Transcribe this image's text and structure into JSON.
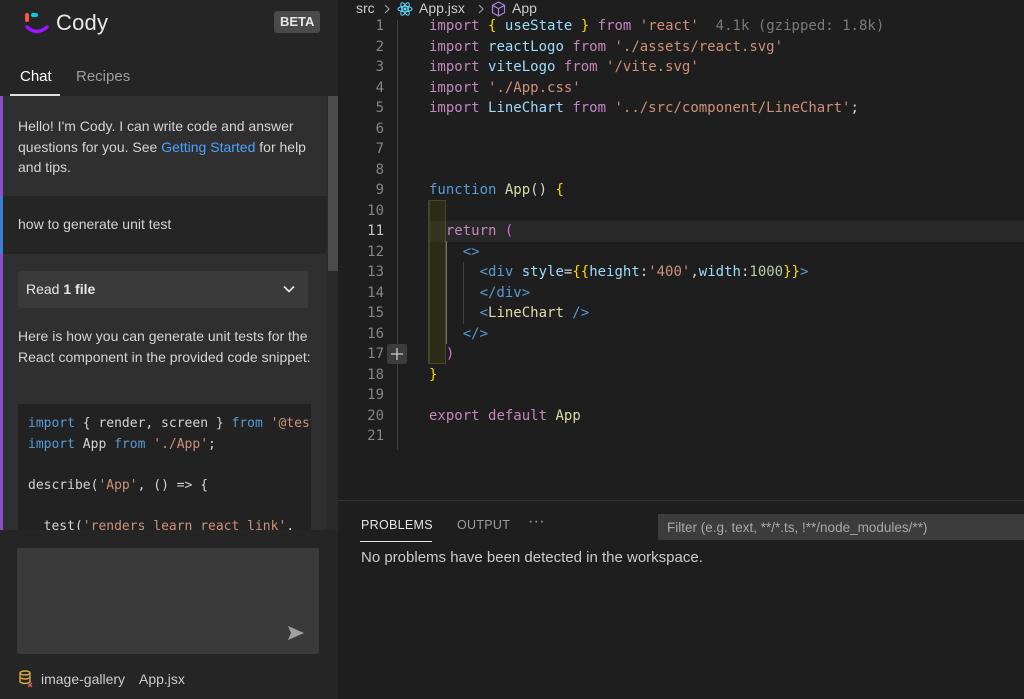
{
  "cody": {
    "title": "Cody",
    "badge": "BETA",
    "tabs": [
      "Chat",
      "Recipes"
    ],
    "greeting_before": "Hello! I'm Cody. I can write code and answer questions for you. See ",
    "greeting_link": "Getting Started",
    "greeting_after": " for help and tips.",
    "user_message": "how to generate unit test",
    "read_label": "Read ",
    "read_count": "1 file",
    "answer": "Here is how you can generate unit tests for the React component in the provided code snippet:",
    "code": [
      [
        {
          "t": "import",
          "c": "kb"
        },
        {
          "t": " { render, screen } ",
          "c": ""
        },
        {
          "t": "from",
          "c": "kb"
        },
        {
          "t": " ",
          "c": ""
        },
        {
          "t": "'@testing-library/react'",
          "c": "str"
        },
        {
          "t": ";",
          "c": ""
        }
      ],
      [
        {
          "t": "import",
          "c": "kb"
        },
        {
          "t": " App ",
          "c": ""
        },
        {
          "t": "from",
          "c": "kb"
        },
        {
          "t": " ",
          "c": ""
        },
        {
          "t": "'./App'",
          "c": "str"
        },
        {
          "t": ";",
          "c": ""
        }
      ],
      [],
      [
        {
          "t": "describe(",
          "c": ""
        },
        {
          "t": "'App'",
          "c": "str"
        },
        {
          "t": ", () => {",
          "c": ""
        }
      ],
      [],
      [
        {
          "t": "  test(",
          "c": ""
        },
        {
          "t": "'renders learn react link'",
          "c": "str"
        },
        {
          "t": ",",
          "c": ""
        }
      ]
    ],
    "context_repo": "image-gallery",
    "context_file": "App.jsx"
  },
  "editor": {
    "breadcrumb": {
      "folder": "src",
      "file": "App.jsx",
      "symbol": "App"
    },
    "current_line": 11,
    "lines": [
      {
        "n": 1,
        "tokens": [
          {
            "t": "import",
            "c": "kw"
          },
          {
            "t": " ",
            "c": ""
          },
          {
            "t": "{",
            "c": "br"
          },
          {
            "t": " ",
            "c": ""
          },
          {
            "t": "useState",
            "c": "id"
          },
          {
            "t": " ",
            "c": ""
          },
          {
            "t": "}",
            "c": "br"
          },
          {
            "t": " ",
            "c": ""
          },
          {
            "t": "from",
            "c": "kw"
          },
          {
            "t": " ",
            "c": ""
          },
          {
            "t": "'react'",
            "c": "str"
          },
          {
            "t": "  4.1k (gzipped: 1.8k)",
            "c": "ghost"
          }
        ]
      },
      {
        "n": 2,
        "tokens": [
          {
            "t": "import",
            "c": "kw"
          },
          {
            "t": " ",
            "c": ""
          },
          {
            "t": "reactLogo",
            "c": "id"
          },
          {
            "t": " ",
            "c": ""
          },
          {
            "t": "from",
            "c": "kw"
          },
          {
            "t": " ",
            "c": ""
          },
          {
            "t": "'./assets/react.svg'",
            "c": "str"
          }
        ]
      },
      {
        "n": 3,
        "tokens": [
          {
            "t": "import",
            "c": "kw"
          },
          {
            "t": " ",
            "c": ""
          },
          {
            "t": "viteLogo",
            "c": "id"
          },
          {
            "t": " ",
            "c": ""
          },
          {
            "t": "from",
            "c": "kw"
          },
          {
            "t": " ",
            "c": ""
          },
          {
            "t": "'/vite.svg'",
            "c": "str"
          }
        ]
      },
      {
        "n": 4,
        "tokens": [
          {
            "t": "import",
            "c": "kw"
          },
          {
            "t": " ",
            "c": ""
          },
          {
            "t": "'./App.css'",
            "c": "str"
          }
        ]
      },
      {
        "n": 5,
        "tokens": [
          {
            "t": "import",
            "c": "kw"
          },
          {
            "t": " ",
            "c": ""
          },
          {
            "t": "LineChart",
            "c": "id"
          },
          {
            "t": " ",
            "c": ""
          },
          {
            "t": "from",
            "c": "kw"
          },
          {
            "t": " ",
            "c": ""
          },
          {
            "t": "'../src/component/LineChart'",
            "c": "str"
          },
          {
            "t": ";",
            "c": ""
          }
        ]
      },
      {
        "n": 6,
        "tokens": []
      },
      {
        "n": 7,
        "tokens": []
      },
      {
        "n": 8,
        "tokens": []
      },
      {
        "n": 9,
        "tokens": [
          {
            "t": "function",
            "c": "kb"
          },
          {
            "t": " ",
            "c": ""
          },
          {
            "t": "App",
            "c": "fn"
          },
          {
            "t": "() ",
            "c": ""
          },
          {
            "t": "{",
            "c": "br"
          }
        ]
      },
      {
        "n": 10,
        "tokens": []
      },
      {
        "n": 11,
        "tokens": [
          {
            "t": "  ",
            "c": ""
          },
          {
            "t": "return",
            "c": "kw"
          },
          {
            "t": " ",
            "c": ""
          },
          {
            "t": "(",
            "c": "br2"
          }
        ]
      },
      {
        "n": 12,
        "tokens": [
          {
            "t": "    ",
            "c": ""
          },
          {
            "t": "<>",
            "c": "tag"
          }
        ]
      },
      {
        "n": 13,
        "tokens": [
          {
            "t": "      ",
            "c": ""
          },
          {
            "t": "<div",
            "c": "tag"
          },
          {
            "t": " ",
            "c": ""
          },
          {
            "t": "style",
            "c": "attr"
          },
          {
            "t": "=",
            "c": ""
          },
          {
            "t": "{{",
            "c": "br"
          },
          {
            "t": "height",
            "c": "attr"
          },
          {
            "t": ":",
            "c": ""
          },
          {
            "t": "'400'",
            "c": "str"
          },
          {
            "t": ",",
            "c": ""
          },
          {
            "t": "width",
            "c": "attr"
          },
          {
            "t": ":",
            "c": ""
          },
          {
            "t": "1000",
            "c": "num"
          },
          {
            "t": "}}",
            "c": "br"
          },
          {
            "t": ">",
            "c": "tag"
          }
        ]
      },
      {
        "n": 14,
        "tokens": [
          {
            "t": "      ",
            "c": ""
          },
          {
            "t": "</div>",
            "c": "tag"
          }
        ]
      },
      {
        "n": 15,
        "tokens": [
          {
            "t": "      ",
            "c": ""
          },
          {
            "t": "<",
            "c": "tag"
          },
          {
            "t": "LineChart",
            "c": "fn"
          },
          {
            "t": " />",
            "c": "tag"
          }
        ]
      },
      {
        "n": 16,
        "tokens": [
          {
            "t": "    ",
            "c": ""
          },
          {
            "t": "</>",
            "c": "tag"
          }
        ]
      },
      {
        "n": 17,
        "tokens": [
          {
            "t": "  ",
            "c": ""
          },
          {
            "t": ")",
            "c": "br2"
          }
        ]
      },
      {
        "n": 18,
        "tokens": [
          {
            "t": "}",
            "c": "br"
          }
        ]
      },
      {
        "n": 19,
        "tokens": []
      },
      {
        "n": 20,
        "tokens": [
          {
            "t": "export",
            "c": "kw"
          },
          {
            "t": " ",
            "c": ""
          },
          {
            "t": "default",
            "c": "kw"
          },
          {
            "t": " ",
            "c": ""
          },
          {
            "t": "App",
            "c": "fn"
          }
        ]
      },
      {
        "n": 21,
        "tokens": []
      }
    ]
  },
  "panel": {
    "tabs": [
      "PROBLEMS",
      "OUTPUT"
    ],
    "more": "···",
    "filter_placeholder": "Filter (e.g. text, **/*.ts, !**/node_modules/**)",
    "message": "No problems have been detected in the workspace."
  },
  "colors": {
    "accent_purple": "#8a4fc9",
    "accent_blue": "#3a7fd1",
    "link": "#4aa3ff"
  }
}
